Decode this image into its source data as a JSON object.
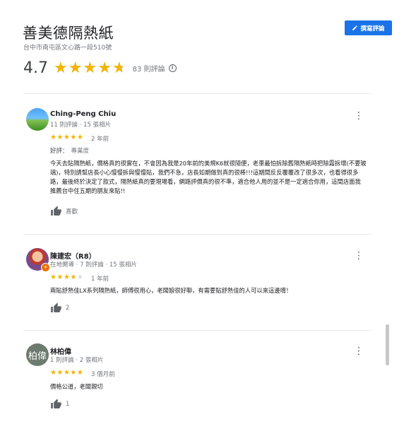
{
  "place": {
    "title": "善美德隔熱紙",
    "address": "台中市南屯區文心路一段510號",
    "write_review_label": "撰寫評論",
    "rating": "4.7",
    "rating_value": 4.7,
    "review_count": "83 則評論"
  },
  "colors": {
    "accent": "#1a73e8",
    "star": "#f4b400"
  },
  "reviews": [
    {
      "name": "Ching-Peng Chiu",
      "meta": "11 則評論 · 15 張相片",
      "stars": 5,
      "date": "2 年前",
      "aspect_label": "好評：",
      "aspect_value": "專業度",
      "text": "今天去貼隔熱紙，價格真的很實在，不會因為我是20年前的美規K6就很隨便，老車最怕拆除舊隔熱紙時把除霧拆壞(不要玻璃)，特別請幫店長小心慢慢拆與慢慢貼，我們不急，店長如期做到真的很棒!!!這期間反反覆覆改了很多次，也看得很多路，最後終於決定了款式，隔熱紙真的要現場看，網路評價真的很不準，適合他人用的並不是一定適合你用，這間店面我推薦台中住五期的朋友來貼!!",
      "like_label": "喜歡",
      "avatar": "landscape-photo"
    },
    {
      "name": "陳建宏（R8）",
      "meta": "在地嚮導 · 7 則評論 · 15 張相片",
      "stars": 4,
      "date": "1 年前",
      "text": "兩貼舒熱佳LX系列隔熱紙，師傅很用心，老闆娘很好聊，有需要貼舒熱佳的人可以來這邊唷！",
      "like_count": "2",
      "avatar": "person-photo",
      "badge": "local-guide-icon"
    },
    {
      "name": "林柏偉",
      "meta": "1 則評論 · 2 張相片",
      "stars": 5,
      "date": "3 個月前",
      "text": "價格公道，老闆親切",
      "like_count": "1",
      "avatar_initials": "柏偉"
    }
  ]
}
